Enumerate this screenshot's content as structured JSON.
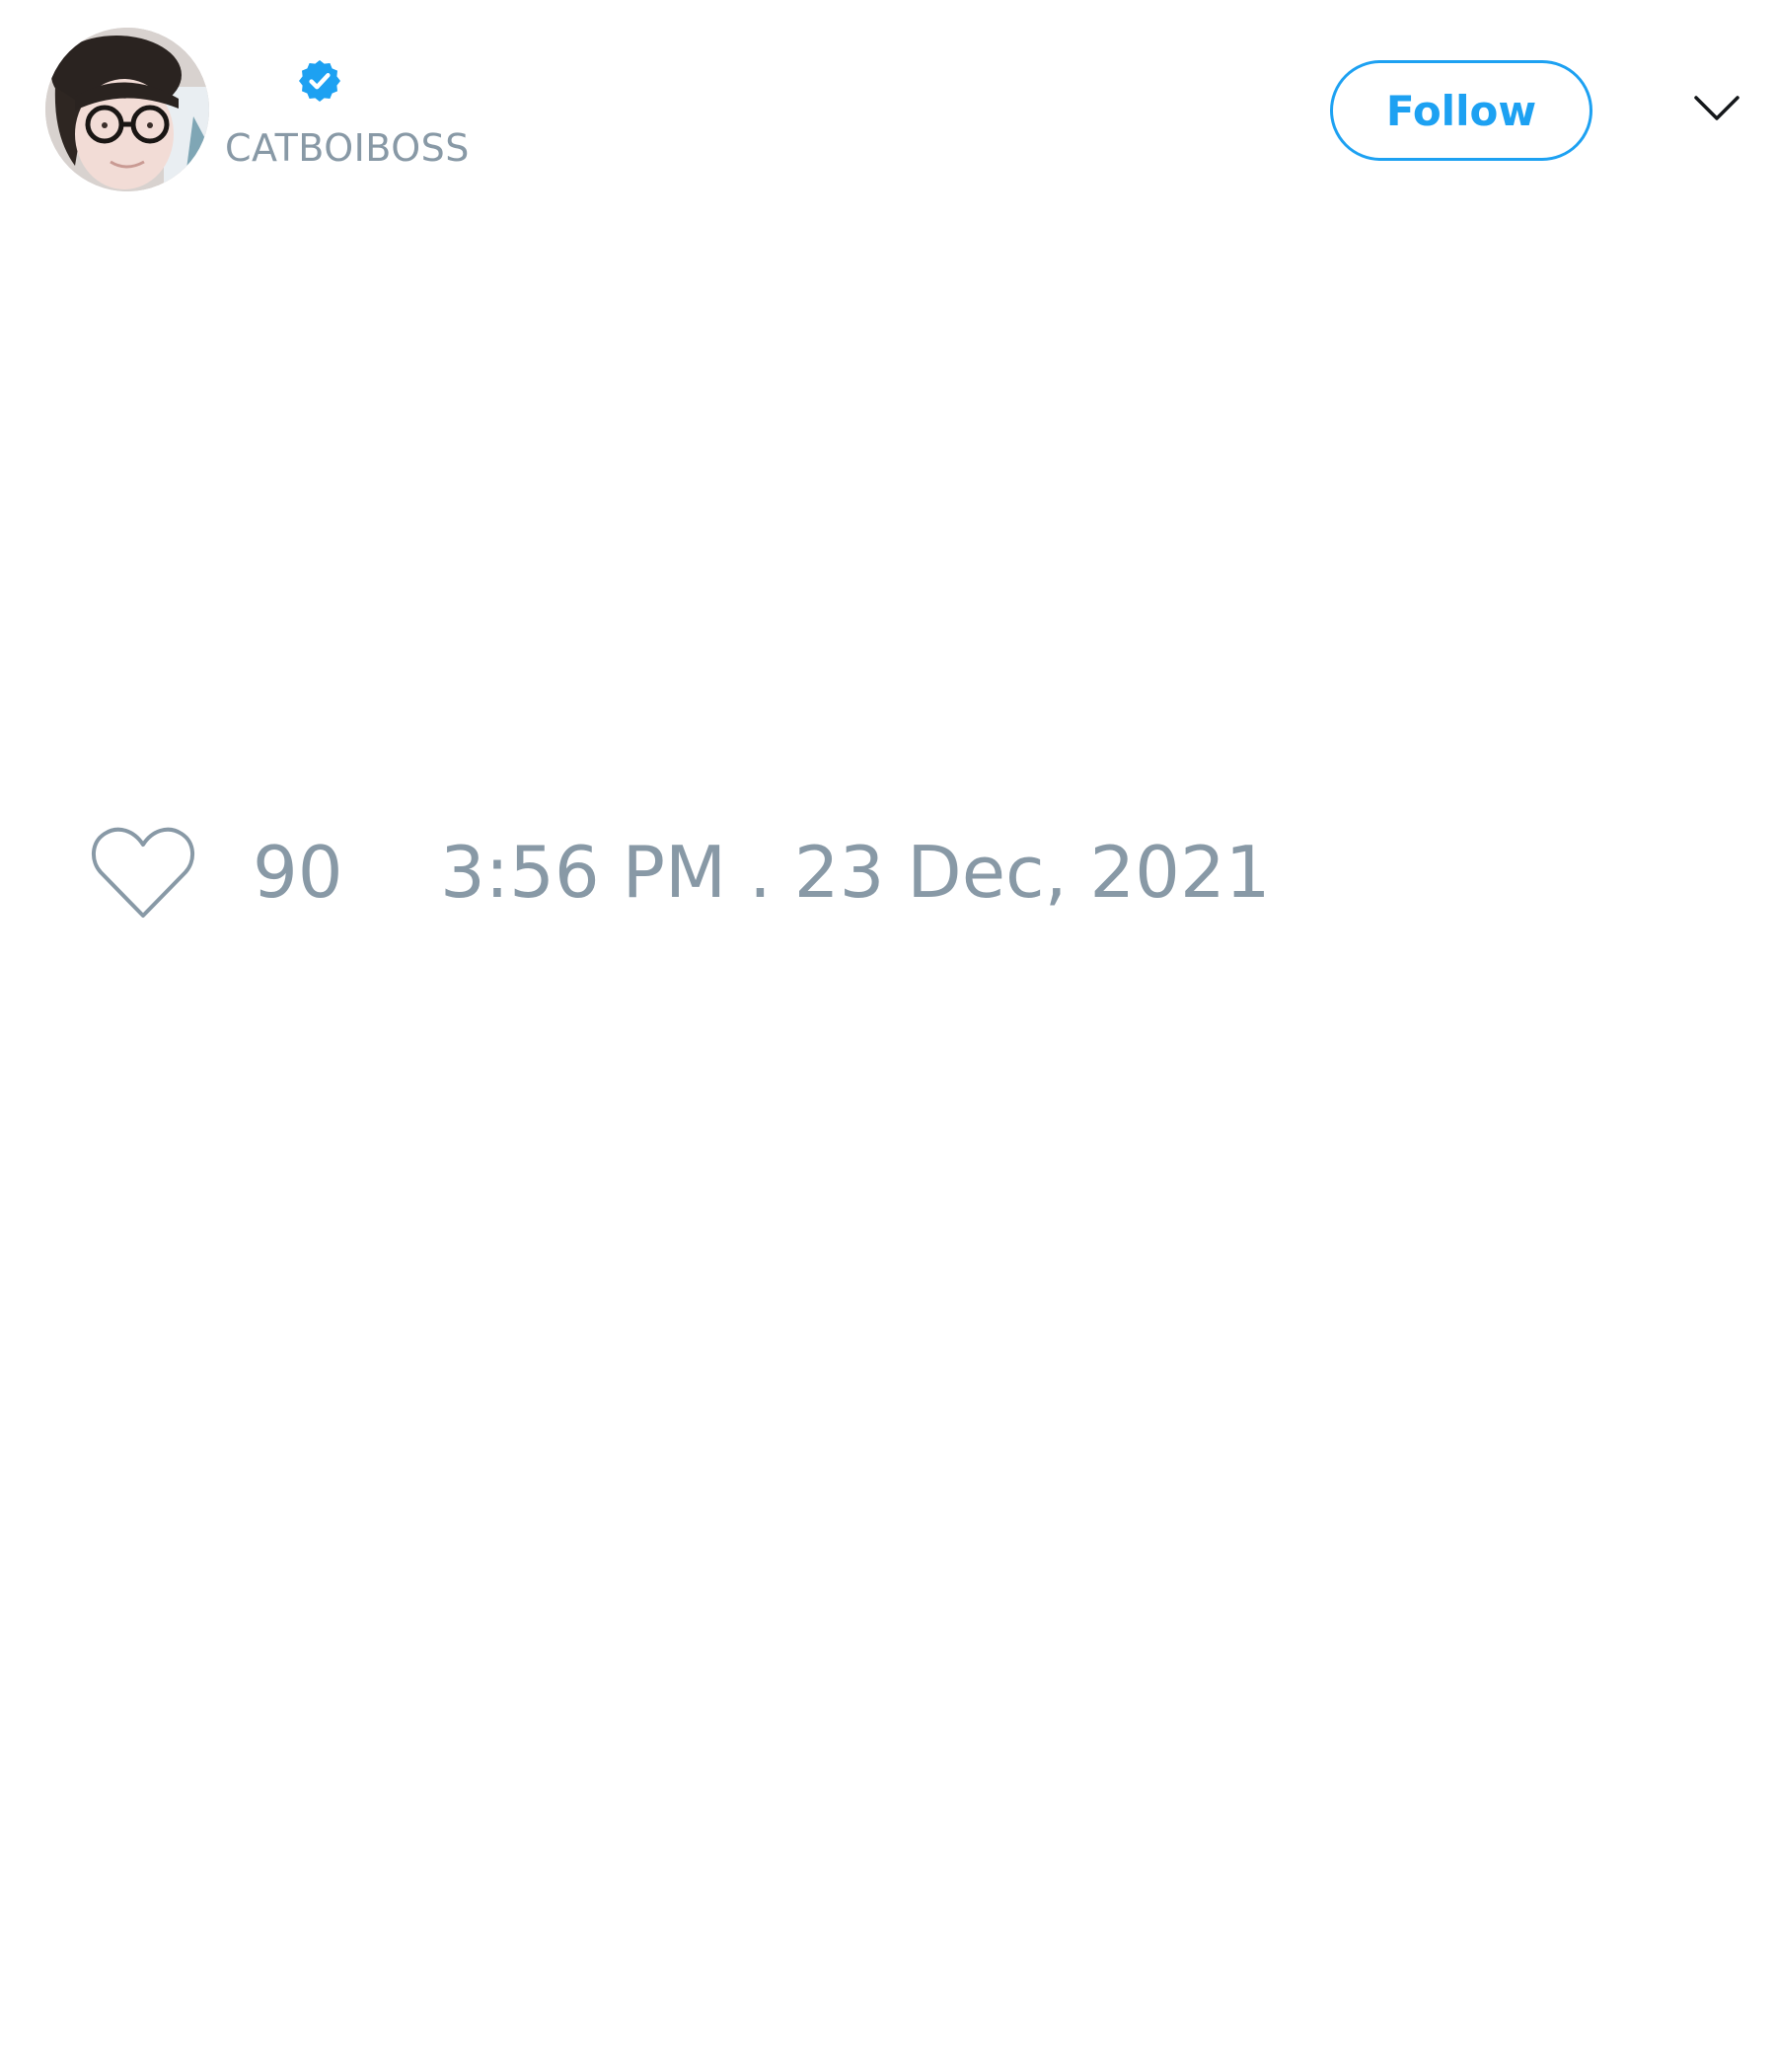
{
  "tweet": {
    "author": {
      "handle": "CATBOIBOSS",
      "verified": true,
      "avatar_icon": "user-photo"
    },
    "actions": {
      "follow_label": "Follow",
      "more_icon": "chevron-down-icon"
    },
    "likes": {
      "icon": "heart-outline-icon",
      "count": "90"
    },
    "timestamp": "3:56 PM . 23 Dec, 2021"
  },
  "colors": {
    "accent": "#1da1f2",
    "muted_text": "#8899a6",
    "background": "#ffffff"
  }
}
